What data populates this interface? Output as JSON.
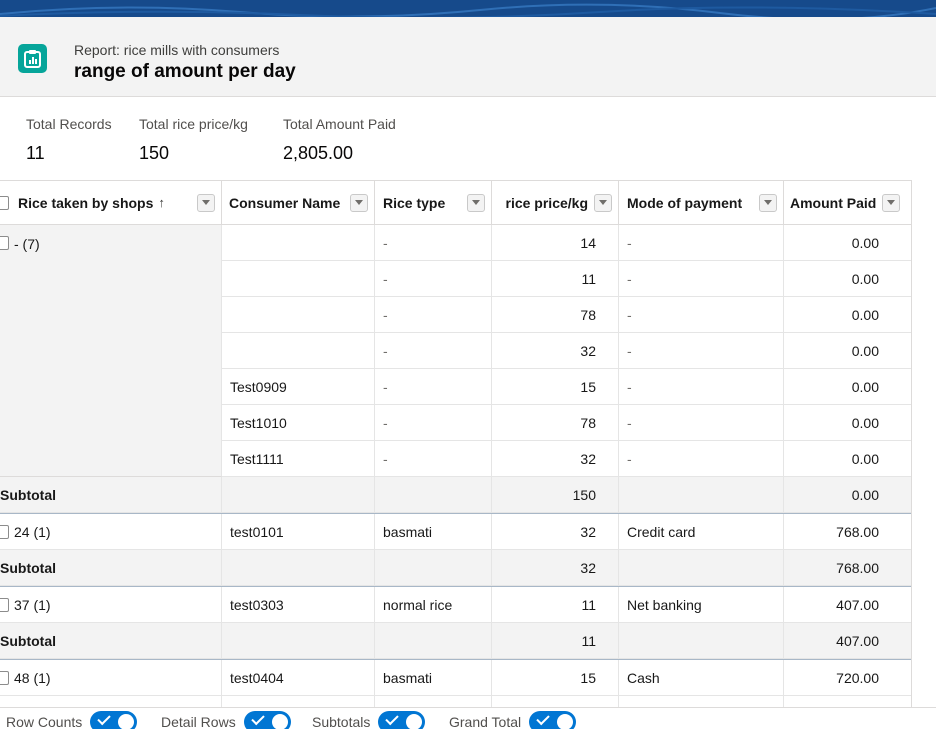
{
  "header": {
    "subtitle": "Report: rice mills with consumers",
    "title": "range of amount per day"
  },
  "summary": {
    "total_records_label": "Total Records",
    "total_records_value": "11",
    "total_price_label": "Total rice price/kg",
    "total_price_value": "150",
    "total_amount_label": "Total Amount Paid",
    "total_amount_value": "2,805.00"
  },
  "columns": {
    "c1": "Rice taken by shops",
    "c1_sort": "↑",
    "c2": "Consumer Name",
    "c3": "Rice type",
    "c4": "rice price/kg",
    "c5": "Mode of payment",
    "c6": "Amount Paid"
  },
  "groups": {
    "g1": "- (7)",
    "g2": "24 (1)",
    "g3": "37 (1)",
    "g4": "48 (1)"
  },
  "rows": [
    {
      "name": "",
      "type": "-",
      "price": "14",
      "mode": "-",
      "amount": "0.00"
    },
    {
      "name": "",
      "type": "-",
      "price": "11",
      "mode": "-",
      "amount": "0.00"
    },
    {
      "name": "",
      "type": "-",
      "price": "78",
      "mode": "-",
      "amount": "0.00"
    },
    {
      "name": "",
      "type": "-",
      "price": "32",
      "mode": "-",
      "amount": "0.00"
    },
    {
      "name": "Test0909",
      "type": "-",
      "price": "15",
      "mode": "-",
      "amount": "0.00"
    },
    {
      "name": "Test1010",
      "type": "-",
      "price": "78",
      "mode": "-",
      "amount": "0.00"
    },
    {
      "name": "Test1111",
      "type": "-",
      "price": "32",
      "mode": "-",
      "amount": "0.00"
    },
    {
      "name": "test0101",
      "type": "basmati",
      "price": "32",
      "mode": "Credit card",
      "amount": "768.00"
    },
    {
      "name": "test0303",
      "type": "normal rice",
      "price": "11",
      "mode": "Net banking",
      "amount": "407.00"
    },
    {
      "name": "test0404",
      "type": "basmati",
      "price": "15",
      "mode": "Cash",
      "amount": "720.00"
    }
  ],
  "subtotals": [
    {
      "label": "Subtotal",
      "price": "150",
      "amount": "0.00"
    },
    {
      "label": "Subtotal",
      "price": "32",
      "amount": "768.00"
    },
    {
      "label": "Subtotal",
      "price": "11",
      "amount": "407.00"
    }
  ],
  "footer": {
    "row_counts": "Row Counts",
    "detail_rows": "Detail Rows",
    "subtotals": "Subtotals",
    "grand_total": "Grand Total"
  },
  "icons": {
    "report": "report-icon",
    "dropdown": "chevron-down-icon",
    "sort": "arrow-up-icon",
    "toggle_check": "check-icon"
  },
  "colors": {
    "brand_bar": "#164a8b",
    "report_icon": "#06a59a",
    "toggle": "#0176d3"
  }
}
